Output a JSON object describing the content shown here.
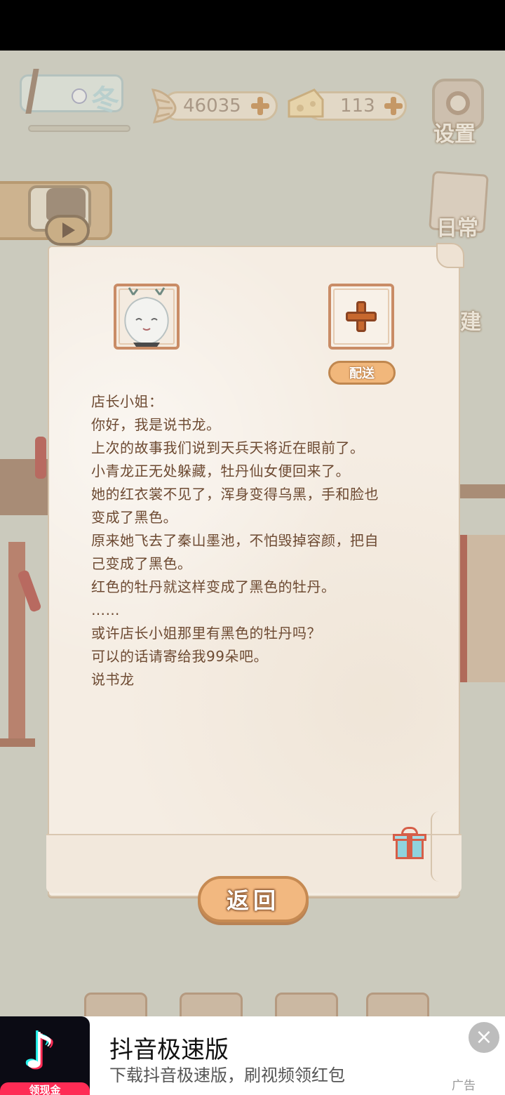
{
  "hud": {
    "season_label": "冬",
    "coins": "46035",
    "cheese": "113",
    "settings_label": "设置",
    "daily_label": "日常",
    "build_label": "建"
  },
  "letter": {
    "deliver_label": "配送",
    "lines": [
      "店长小姐：",
      "你好，我是说书龙。",
      "上次的故事我们说到天兵天将近在眼前了。",
      "小青龙正无处躲藏，牡丹仙女便回来了。",
      "她的红衣裳不见了，浑身变得乌黑，手和脸也",
      "变成了黑色。",
      "原来她飞去了秦山墨池，不怕毁掉容颜，把自",
      "己变成了黑色。",
      "红色的牡丹就这样变成了黑色的牡丹。",
      "……",
      "或许店长小姐那里有黑色的牡丹吗？",
      "可以的话请寄给我99朵吧。",
      "说书龙"
    ],
    "return_label": "返回"
  },
  "ad": {
    "title": "抖音极速版",
    "subtitle": "下载抖音极速版，刷视频领红包",
    "badge": "领现金",
    "close_icon": "×",
    "mark": "广告"
  },
  "colors": {
    "paper": "#f5ede3",
    "ink": "#6d4a32",
    "button_orange": "#f2b880",
    "plus_orange": "#c7682e"
  }
}
